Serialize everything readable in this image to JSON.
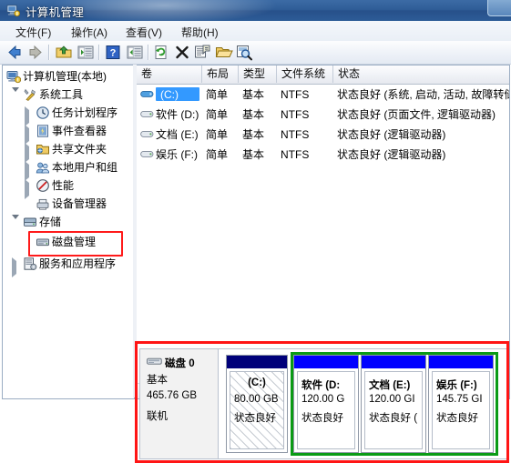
{
  "window": {
    "title": "计算机管理",
    "icon": "computer-management-icon",
    "accent_titlebar": "#2f5d97",
    "highlight_red": "#ff1515",
    "highlight_green": "#0a9b15"
  },
  "menu": {
    "items": [
      {
        "label": "文件(F)",
        "name": "menu-file"
      },
      {
        "label": "操作(A)",
        "name": "menu-action"
      },
      {
        "label": "查看(V)",
        "name": "menu-view"
      },
      {
        "label": "帮助(H)",
        "name": "menu-help"
      }
    ]
  },
  "toolbar": {
    "buttons": [
      {
        "icon": "back-arrow-icon",
        "label": "后退"
      },
      {
        "icon": "forward-arrow-icon",
        "label": "前进"
      },
      {
        "icon": "up-folder-icon",
        "label": "向上"
      },
      {
        "icon": "show-hide-tree-icon",
        "label": "显示/隐藏控制台树"
      },
      {
        "icon": "help-question-icon",
        "label": "帮助"
      },
      {
        "icon": "properties-pane-icon",
        "label": "显示/隐藏操作窗格"
      },
      {
        "icon": "refresh-icon",
        "label": "刷新"
      },
      {
        "icon": "delete-x-icon",
        "label": "删除"
      },
      {
        "icon": "properties-icon",
        "label": "属性"
      },
      {
        "icon": "open-folder-icon",
        "label": "打开"
      },
      {
        "icon": "search-magnifier-icon",
        "label": "查找"
      }
    ]
  },
  "tree": {
    "root": {
      "label": "计算机管理(本地)",
      "icon": "computer-icon"
    },
    "items": [
      {
        "label": "系统工具",
        "icon": "tools-icon",
        "indent": 0,
        "expander": "down"
      },
      {
        "label": "任务计划程序",
        "icon": "clock-icon",
        "indent": 1,
        "expander": "right"
      },
      {
        "label": "事件查看器",
        "icon": "event-viewer-icon",
        "indent": 1,
        "expander": "right"
      },
      {
        "label": "共享文件夹",
        "icon": "shared-folder-icon",
        "indent": 1,
        "expander": "right"
      },
      {
        "label": "本地用户和组",
        "icon": "users-icon",
        "indent": 1,
        "expander": "right"
      },
      {
        "label": "性能",
        "icon": "performance-icon",
        "indent": 1,
        "expander": "right"
      },
      {
        "label": "设备管理器",
        "icon": "device-manager-icon",
        "indent": 1,
        "expander": "none"
      },
      {
        "label": "存储",
        "icon": "storage-icon",
        "indent": 0,
        "expander": "down"
      },
      {
        "label": "磁盘管理",
        "icon": "disk-management-icon",
        "indent": 1,
        "expander": "none",
        "highlighted": true
      },
      {
        "label": "服务和应用程序",
        "icon": "services-icon",
        "indent": 0,
        "expander": "right"
      }
    ]
  },
  "volume_list": {
    "columns": [
      {
        "label": "卷",
        "name": "column-volume"
      },
      {
        "label": "布局",
        "name": "column-layout"
      },
      {
        "label": "类型",
        "name": "column-type"
      },
      {
        "label": "文件系统",
        "name": "column-filesystem"
      },
      {
        "label": "状态",
        "name": "column-status"
      }
    ],
    "rows": [
      {
        "volume": "(C:)",
        "layout": "简单",
        "type": "基本",
        "filesystem": "NTFS",
        "status": "状态良好 (系统, 启动, 活动, 故障转储",
        "selected": true,
        "icon": "volume-icon-selected"
      },
      {
        "volume": "软件 (D:)",
        "layout": "简单",
        "type": "基本",
        "filesystem": "NTFS",
        "status": "状态良好 (页面文件, 逻辑驱动器)",
        "selected": false,
        "icon": "volume-icon"
      },
      {
        "volume": "文档 (E:)",
        "layout": "简单",
        "type": "基本",
        "filesystem": "NTFS",
        "status": "状态良好 (逻辑驱动器)",
        "selected": false,
        "icon": "volume-icon"
      },
      {
        "volume": "娱乐 (F:)",
        "layout": "简单",
        "type": "基本",
        "filesystem": "NTFS",
        "status": "状态良好 (逻辑驱动器)",
        "selected": false,
        "icon": "volume-icon"
      }
    ]
  },
  "graphical_view": {
    "disk": {
      "name": "磁盘 0",
      "type": "基本",
      "capacity": "465.76 GB",
      "state": "联机",
      "icon": "disk-icon"
    },
    "partitions": [
      {
        "name": "(C:)",
        "size": "80.00 GB",
        "status": "状态良好",
        "bar_color": "#00007a",
        "hatched": true,
        "in_green_box": false
      },
      {
        "name": "软件 (D:",
        "size": "120.00 G",
        "status": "状态良好",
        "bar_color": "#0000ff",
        "hatched": false,
        "in_green_box": true
      },
      {
        "name": "文档 (E:)",
        "size": "120.00 GI",
        "status": "状态良好 (",
        "bar_color": "#0000ff",
        "hatched": false,
        "in_green_box": true
      },
      {
        "name": "娱乐 (F:)",
        "size": "145.75 GI",
        "status": "状态良好",
        "bar_color": "#0000ff",
        "hatched": false,
        "in_green_box": true
      }
    ]
  },
  "scrollbar": {
    "left_arrow": "◄",
    "right_arrow": "►"
  }
}
